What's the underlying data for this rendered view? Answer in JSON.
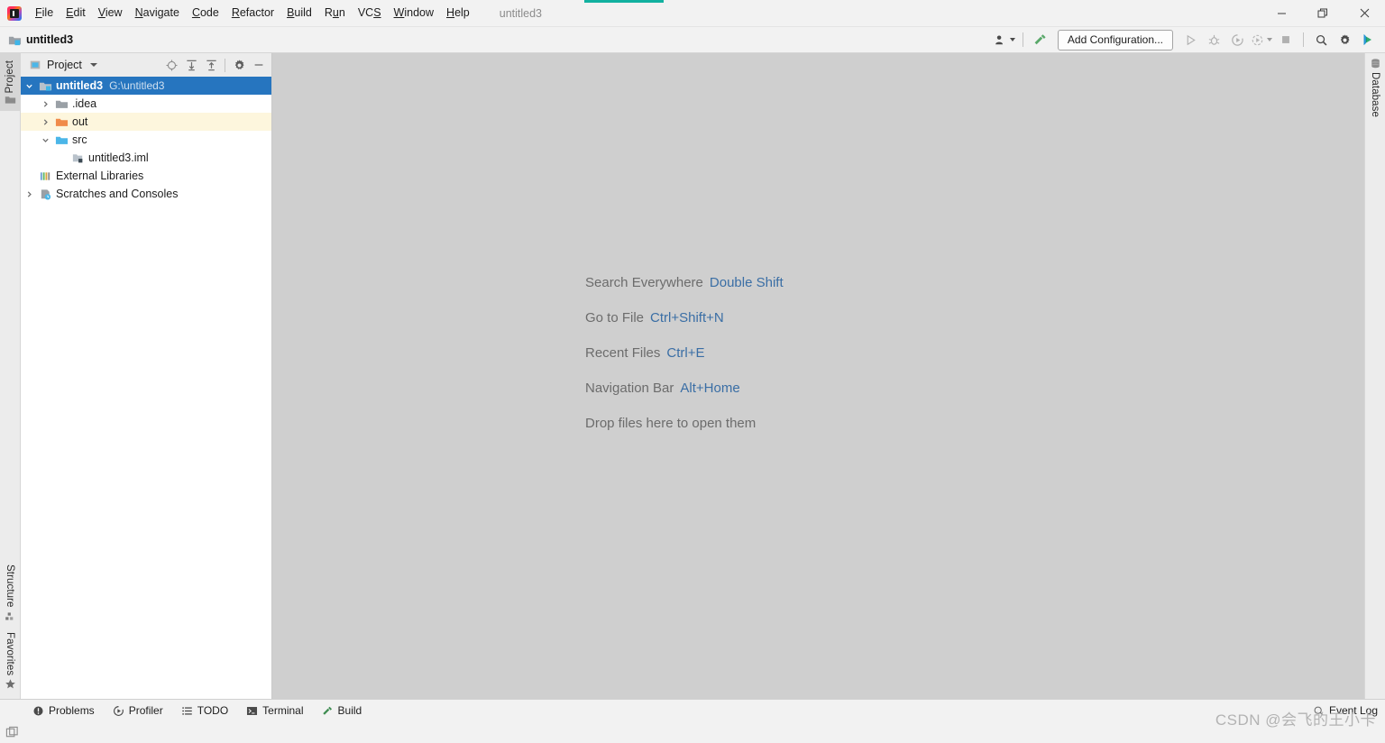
{
  "window": {
    "project_name": "untitled3",
    "logo_icon": "intellij-idea-logo",
    "controls": [
      {
        "name": "minimize",
        "icon": "minimize-icon"
      },
      {
        "name": "maximize",
        "icon": "restore-icon"
      },
      {
        "name": "close",
        "icon": "close-icon"
      }
    ]
  },
  "menubar": {
    "items": [
      {
        "label": "File",
        "mnemonic": "F"
      },
      {
        "label": "Edit",
        "mnemonic": "E"
      },
      {
        "label": "View",
        "mnemonic": "V"
      },
      {
        "label": "Navigate",
        "mnemonic": "N"
      },
      {
        "label": "Code",
        "mnemonic": "C"
      },
      {
        "label": "Refactor",
        "mnemonic": "R"
      },
      {
        "label": "Build",
        "mnemonic": "B"
      },
      {
        "label": "Run",
        "mnemonic": "u"
      },
      {
        "label": "VCS",
        "mnemonic": "S"
      },
      {
        "label": "Window",
        "mnemonic": "W"
      },
      {
        "label": "Help",
        "mnemonic": "H"
      }
    ]
  },
  "navbar": {
    "breadcrumb": "untitled3",
    "breadcrumb_icon": "project-folder-icon",
    "toolbar": {
      "user_icon": "user-account-icon",
      "build_icon": "build-hammer-icon",
      "run_config_label": "Add Configuration...",
      "run_icon": "run-icon",
      "debug_icon": "debug-icon",
      "run_coverage_icon": "run-with-coverage-icon",
      "profile_icon": "profile-icon",
      "stop_icon": "stop-icon",
      "search_icon": "search-icon",
      "settings_icon": "gear-icon",
      "updates_icon": "ide-update-icon"
    }
  },
  "left_rail": {
    "top_tabs": [
      {
        "label": "Project",
        "icon": "project-panel-icon",
        "active": true
      }
    ],
    "bottom_tabs": [
      {
        "label": "Structure",
        "icon": "structure-icon"
      },
      {
        "label": "Favorites",
        "icon": "star-icon"
      }
    ]
  },
  "right_rail": {
    "tabs": [
      {
        "label": "Database",
        "icon": "database-icon"
      }
    ]
  },
  "project_panel": {
    "title": "Project",
    "title_icon": "project-panel-icon",
    "dropdown_icon": "chevron-down-icon",
    "actions": [
      {
        "name": "select-opened-file",
        "icon": "crosshair-target-icon"
      },
      {
        "name": "expand-all",
        "icon": "expand-all-icon"
      },
      {
        "name": "collapse-all",
        "icon": "collapse-all-icon"
      },
      {
        "name": "settings",
        "icon": "gear-icon"
      },
      {
        "name": "hide",
        "icon": "minimize-icon"
      }
    ],
    "tree": [
      {
        "label": "untitled3",
        "path": "G:\\untitled3",
        "icon": "project-root-icon",
        "indent": 0,
        "arrow": "expanded",
        "state": "selected"
      },
      {
        "label": ".idea",
        "path": "",
        "icon": "folder-gray-icon",
        "indent": 1,
        "arrow": "collapsed",
        "state": "normal"
      },
      {
        "label": "out",
        "path": "",
        "icon": "folder-orange-icon",
        "indent": 1,
        "arrow": "collapsed",
        "state": "highlight"
      },
      {
        "label": "src",
        "path": "",
        "icon": "folder-blue-icon",
        "indent": 1,
        "arrow": "expanded",
        "state": "normal"
      },
      {
        "label": "untitled3.iml",
        "path": "",
        "icon": "iml-module-file-icon",
        "indent": 2,
        "arrow": "none",
        "state": "normal"
      },
      {
        "label": "External Libraries",
        "path": "",
        "icon": "external-libraries-icon",
        "indent": 1,
        "arrow": "none",
        "state": "normal"
      },
      {
        "label": "Scratches and Consoles",
        "path": "",
        "icon": "scratches-icon",
        "indent": 0,
        "arrow": "collapsed",
        "state": "normal"
      }
    ]
  },
  "editor": {
    "hints": [
      {
        "label": "Search Everywhere",
        "shortcut": "Double Shift"
      },
      {
        "label": "Go to File",
        "shortcut": "Ctrl+Shift+N"
      },
      {
        "label": "Recent Files",
        "shortcut": "Ctrl+E"
      },
      {
        "label": "Navigation Bar",
        "shortcut": "Alt+Home"
      },
      {
        "label": "Drop files here to open them",
        "shortcut": ""
      }
    ]
  },
  "statusbar": {
    "tools": [
      {
        "label": "Problems",
        "icon": "problems-icon"
      },
      {
        "label": "Profiler",
        "icon": "profiler-icon"
      },
      {
        "label": "TODO",
        "icon": "todo-list-icon"
      },
      {
        "label": "Terminal",
        "icon": "terminal-icon"
      },
      {
        "label": "Build",
        "icon": "build-hammer-icon"
      }
    ],
    "event_log": {
      "label": "Event Log",
      "icon": "event-log-icon"
    }
  },
  "watermark": {
    "text": "CSDN @会飞的王小卡"
  },
  "colors": {
    "accent_teal": "#12b1a0",
    "selection_blue": "#2675bf",
    "shortcut_blue": "#3a6ea5",
    "editor_bg": "#cfcfcf",
    "highlight_yellow": "#fdf6dd",
    "folder_orange": "#f08b4a",
    "folder_blue": "#4bb6e8"
  }
}
